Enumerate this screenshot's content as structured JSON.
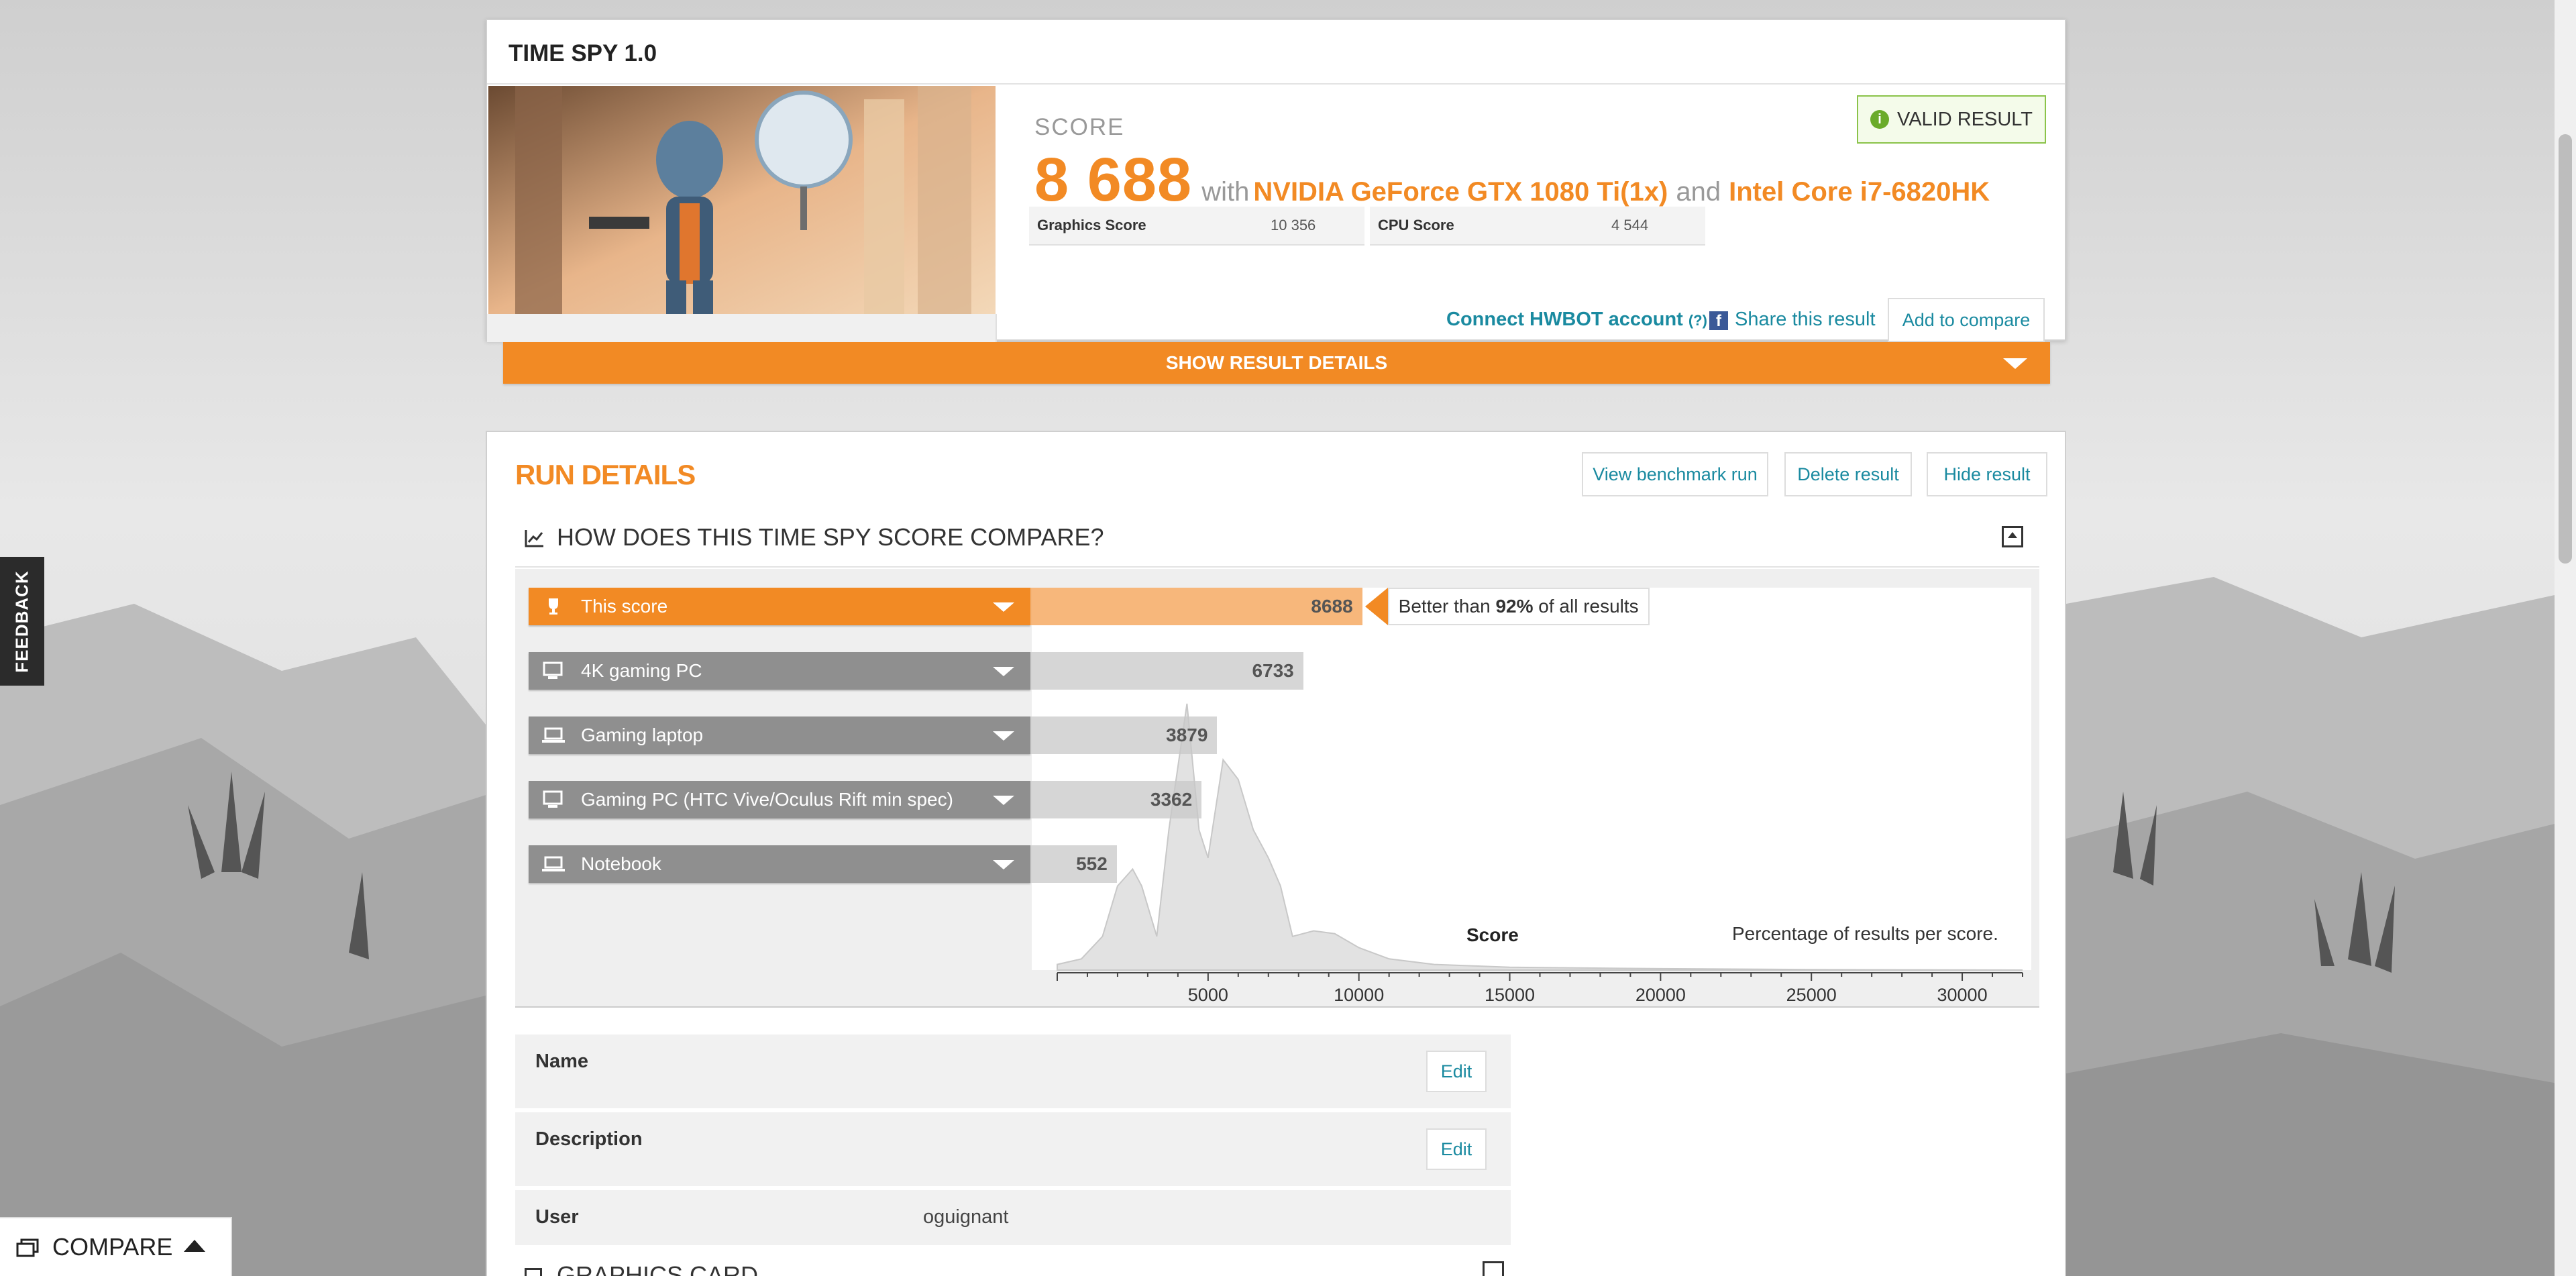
{
  "result": {
    "title": "TIME SPY 1.0",
    "score_label": "SCORE",
    "score_value": "8 688",
    "with_text": "with",
    "gpu": "NVIDIA GeForce GTX 1080 Ti(1x)",
    "and_text": "and",
    "cpu": "Intel Core i7-6820HK",
    "valid_label": "VALID RESULT",
    "graphics_score_label": "Graphics Score",
    "graphics_score_value": "10 356",
    "cpu_score_label": "CPU Score",
    "cpu_score_value": "4 544",
    "hwbot_label": "Connect HWBOT account",
    "hwbot_help": "(?)",
    "share_label": "Share this result",
    "add_compare_label": "Add to compare",
    "show_details_label": "SHOW RESULT DETAILS"
  },
  "run_details": {
    "title": "RUN DETAILS",
    "view_run_label": "View benchmark run",
    "delete_label": "Delete result",
    "hide_label": "Hide result",
    "compare_title": "HOW DOES THIS TIME SPY SCORE COMPARE?",
    "better_prefix": "Better than",
    "better_pct": "92%",
    "better_suffix": "of all results",
    "info": {
      "name_label": "Name",
      "description_label": "Description",
      "user_label": "User",
      "user_value": "oguignant",
      "edit_label": "Edit"
    },
    "graphics_card_title": "GRAPHICS CARD"
  },
  "chart_data": {
    "type": "area",
    "xlabel": "Score",
    "note": "Percentage of results per score.",
    "xlim": [
      0,
      32000
    ],
    "x_ticks": [
      5000,
      10000,
      15000,
      20000,
      25000,
      30000
    ],
    "distribution": {
      "x": [
        0,
        800,
        1500,
        2000,
        2500,
        2800,
        3300,
        3700,
        4300,
        4700,
        5000,
        5500,
        6000,
        6500,
        7000,
        7400,
        7800,
        8500,
        9200,
        10000,
        11000,
        12500,
        15000,
        20000,
        25000,
        32000
      ],
      "y": [
        2,
        4,
        12,
        30,
        36,
        30,
        12,
        50,
        95,
        50,
        40,
        75,
        68,
        50,
        40,
        30,
        12,
        14,
        13,
        8,
        4,
        2,
        1,
        0.5,
        0.2,
        0
      ]
    },
    "comparisons": [
      {
        "label": "This score",
        "value": 8688
      },
      {
        "label": "4K gaming PC",
        "value": 6733
      },
      {
        "label": "Gaming laptop",
        "value": 3879
      },
      {
        "label": "Gaming PC (HTC Vive/Oculus Rift min spec)",
        "value": 3362
      },
      {
        "label": "Notebook",
        "value": 552
      }
    ]
  },
  "feedback_label": "FEEDBACK",
  "compare_bar_label": "COMPARE",
  "colors": {
    "accent": "#f28a24",
    "link": "#1a8aa0",
    "valid": "#8bc34a"
  }
}
